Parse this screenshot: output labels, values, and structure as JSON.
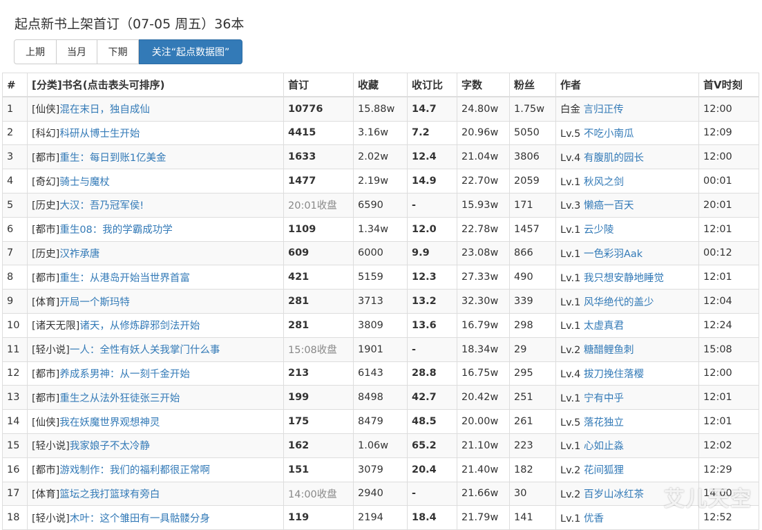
{
  "page": {
    "title": "起点新书上架首订（07-05 周五）36本"
  },
  "buttons": {
    "prev": "上期",
    "current": "当月",
    "next": "下期",
    "follow": "关注“起点数据图”"
  },
  "table": {
    "headers": [
      "#",
      "[分类]书名(点击表头可排序)",
      "首订",
      "收藏",
      "收订比",
      "字数",
      "粉丝",
      "作者",
      "首V时刻"
    ],
    "rows": [
      {
        "no": "1",
        "cat": "[仙侠]",
        "title": "混在末日，独自成仙",
        "sub": "10776",
        "sub_muted": false,
        "fav": "15.88w",
        "ratio": "14.7",
        "words": "24.80w",
        "fans": "1.75w",
        "level": "白金",
        "author": "言归正传",
        "time": "12:00"
      },
      {
        "no": "2",
        "cat": "[科幻]",
        "title": "科研从博士生开始",
        "sub": "4415",
        "sub_muted": false,
        "fav": "3.16w",
        "ratio": "7.2",
        "words": "20.96w",
        "fans": "5050",
        "level": "Lv.5",
        "author": "不吃小南瓜",
        "time": "12:09"
      },
      {
        "no": "3",
        "cat": "[都市]",
        "title": "重生：每日到账1亿美金",
        "sub": "1633",
        "sub_muted": false,
        "fav": "2.02w",
        "ratio": "12.4",
        "words": "21.04w",
        "fans": "3806",
        "level": "Lv.4",
        "author": "有腹肌的园长",
        "time": "12:00"
      },
      {
        "no": "4",
        "cat": "[奇幻]",
        "title": "骑士与魔杖",
        "sub": "1477",
        "sub_muted": false,
        "fav": "2.19w",
        "ratio": "14.9",
        "words": "22.70w",
        "fans": "2059",
        "level": "Lv.1",
        "author": "秋风之剑",
        "time": "00:01"
      },
      {
        "no": "5",
        "cat": "[历史]",
        "title": "大汉：吾乃冠军侯!",
        "sub": "20:01收盘",
        "sub_muted": true,
        "fav": "6590",
        "ratio": "-",
        "words": "15.93w",
        "fans": "171",
        "level": "Lv.3",
        "author": "懒癌一百天",
        "time": "20:01"
      },
      {
        "no": "6",
        "cat": "[都市]",
        "title": "重生08：我的学霸成功学",
        "sub": "1109",
        "sub_muted": false,
        "fav": "1.34w",
        "ratio": "12.0",
        "words": "22.78w",
        "fans": "1457",
        "level": "Lv.1",
        "author": "云少陵",
        "time": "12:01"
      },
      {
        "no": "7",
        "cat": "[历史]",
        "title": "汉祚承唐",
        "sub": "609",
        "sub_muted": false,
        "fav": "6000",
        "ratio": "9.9",
        "words": "23.08w",
        "fans": "866",
        "level": "Lv.1",
        "author": "一色彩羽Aak",
        "time": "00:12"
      },
      {
        "no": "8",
        "cat": "[都市]",
        "title": "重生：从港岛开始当世界首富",
        "sub": "421",
        "sub_muted": false,
        "fav": "5159",
        "ratio": "12.3",
        "words": "27.33w",
        "fans": "490",
        "level": "Lv.1",
        "author": "我只想安静地睡觉",
        "time": "12:01"
      },
      {
        "no": "9",
        "cat": "[体育]",
        "title": "开局一个斯玛特",
        "sub": "281",
        "sub_muted": false,
        "fav": "3713",
        "ratio": "13.2",
        "words": "32.30w",
        "fans": "339",
        "level": "Lv.1",
        "author": "风华绝代的盖少",
        "time": "12:04"
      },
      {
        "no": "10",
        "cat": "[诸天无限]",
        "title": "诸天，从修炼辟邪剑法开始",
        "sub": "281",
        "sub_muted": false,
        "fav": "3809",
        "ratio": "13.6",
        "words": "16.79w",
        "fans": "298",
        "level": "Lv.1",
        "author": "太虚真君",
        "time": "12:24"
      },
      {
        "no": "11",
        "cat": "[轻小说]",
        "title": "一人：全性有妖人关我掌门什么事",
        "sub": "15:08收盘",
        "sub_muted": true,
        "fav": "1901",
        "ratio": "-",
        "words": "18.34w",
        "fans": "29",
        "level": "Lv.2",
        "author": "糖醋鲤鱼刺",
        "time": "15:08"
      },
      {
        "no": "12",
        "cat": "[都市]",
        "title": "养成系男神：从一刻千金开始",
        "sub": "213",
        "sub_muted": false,
        "fav": "6143",
        "ratio": "28.8",
        "words": "16.75w",
        "fans": "295",
        "level": "Lv.4",
        "author": "拔刀挽住落樱",
        "time": "12:00"
      },
      {
        "no": "13",
        "cat": "[都市]",
        "title": "重生之从法外狂徒张三开始",
        "sub": "199",
        "sub_muted": false,
        "fav": "8498",
        "ratio": "42.7",
        "words": "20.42w",
        "fans": "251",
        "level": "Lv.1",
        "author": "宁有中乎",
        "time": "12:01"
      },
      {
        "no": "14",
        "cat": "[仙侠]",
        "title": "我在妖魔世界观想神灵",
        "sub": "175",
        "sub_muted": false,
        "fav": "8479",
        "ratio": "48.5",
        "words": "20.00w",
        "fans": "261",
        "level": "Lv.5",
        "author": "落花独立",
        "time": "12:01"
      },
      {
        "no": "15",
        "cat": "[轻小说]",
        "title": "我家娘子不太冷静",
        "sub": "162",
        "sub_muted": false,
        "fav": "1.06w",
        "ratio": "65.2",
        "words": "21.10w",
        "fans": "223",
        "level": "Lv.1",
        "author": "心如止淼",
        "time": "12:02"
      },
      {
        "no": "16",
        "cat": "[都市]",
        "title": "游戏制作：我们的福利都很正常啊",
        "sub": "151",
        "sub_muted": false,
        "fav": "3079",
        "ratio": "20.4",
        "words": "21.40w",
        "fans": "182",
        "level": "Lv.2",
        "author": "花间狐狸",
        "time": "12:29"
      },
      {
        "no": "17",
        "cat": "[体育]",
        "title": "篮坛之我打篮球有旁白",
        "sub": "14:00收盘",
        "sub_muted": true,
        "fav": "2940",
        "ratio": "-",
        "words": "21.66w",
        "fans": "30",
        "level": "Lv.2",
        "author": "百岁山冰红茶",
        "time": "14:00"
      },
      {
        "no": "18",
        "cat": "[轻小说]",
        "title": "木叶：这个雏田有一具骷髅分身",
        "sub": "119",
        "sub_muted": false,
        "fav": "2194",
        "ratio": "18.4",
        "words": "21.79w",
        "fans": "141",
        "level": "Lv.1",
        "author": "优香",
        "time": "12:52"
      }
    ]
  },
  "watermark": "艾儿天空"
}
